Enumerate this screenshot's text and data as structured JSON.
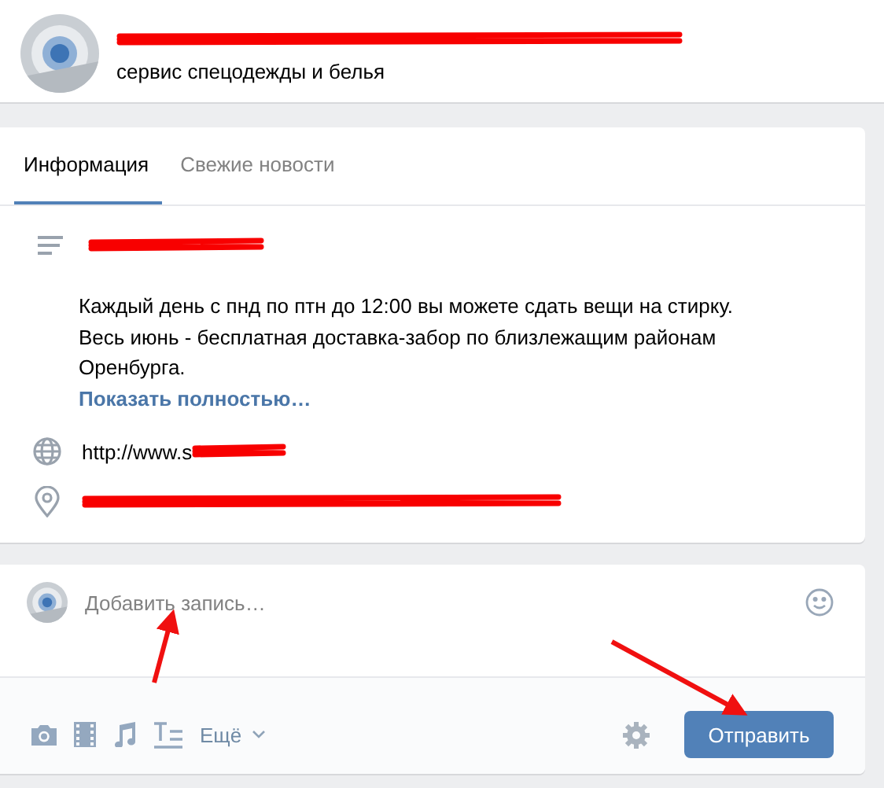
{
  "header": {
    "subtitle": "сервис спецодежды и белья"
  },
  "tabs": [
    {
      "label": "Информация",
      "selected": true
    },
    {
      "label": "Свежие новости",
      "selected": false
    }
  ],
  "info": {
    "paragraphs": [
      "Каждый день с пнд по птн до 12:00 вы можете сдать вещи на стирку.",
      "Весь июнь - бесплатная доставка-забор по близлежащим районам Оренбурга."
    ],
    "show_more": "Показать полностью…",
    "website": "http://www.s"
  },
  "composer": {
    "placeholder": "Добавить запись…",
    "more": "Ещё",
    "submit": "Отправить"
  }
}
